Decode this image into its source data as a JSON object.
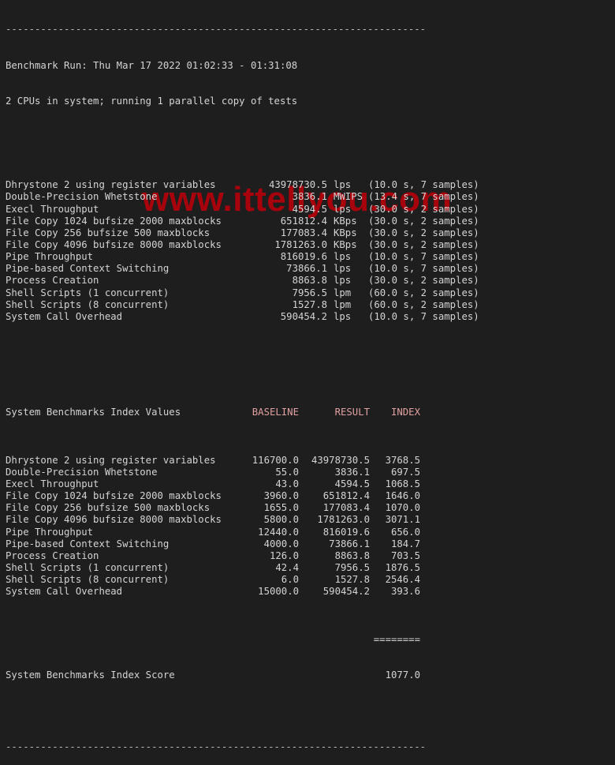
{
  "terminal": {
    "separator": "------------------------------------------------------------------------",
    "run_header": "Benchmark Run: Thu Mar 17 2022 01:02:33 - 01:31:08",
    "cpu_info": "2 CPUs in system; running 1 parallel copy of tests",
    "results": [
      {
        "name": "Dhrystone 2 using register variables",
        "value": "43978730.5",
        "unit": "lps",
        "info": "(10.0 s, 7 samples)"
      },
      {
        "name": "Double-Precision Whetstone",
        "value": "3836.1",
        "unit": "MWIPS",
        "info": "(13.4 s, 7 samples)"
      },
      {
        "name": "Execl Throughput",
        "value": "4594.5",
        "unit": "lps",
        "info": "(30.0 s, 2 samples)"
      },
      {
        "name": "File Copy 1024 bufsize 2000 maxblocks",
        "value": "651812.4",
        "unit": "KBps",
        "info": "(30.0 s, 2 samples)"
      },
      {
        "name": "File Copy 256 bufsize 500 maxblocks",
        "value": "177083.4",
        "unit": "KBps",
        "info": "(30.0 s, 2 samples)"
      },
      {
        "name": "File Copy 4096 bufsize 8000 maxblocks",
        "value": "1781263.0",
        "unit": "KBps",
        "info": "(30.0 s, 2 samples)"
      },
      {
        "name": "Pipe Throughput",
        "value": "816019.6",
        "unit": "lps",
        "info": "(10.0 s, 7 samples)"
      },
      {
        "name": "Pipe-based Context Switching",
        "value": "73866.1",
        "unit": "lps",
        "info": "(10.0 s, 7 samples)"
      },
      {
        "name": "Process Creation",
        "value": "8863.8",
        "unit": "lps",
        "info": "(30.0 s, 2 samples)"
      },
      {
        "name": "Shell Scripts (1 concurrent)",
        "value": "7956.5",
        "unit": "lpm",
        "info": "(60.0 s, 2 samples)"
      },
      {
        "name": "Shell Scripts (8 concurrent)",
        "value": "1527.8",
        "unit": "lpm",
        "info": "(60.0 s, 2 samples)"
      },
      {
        "name": "System Call Overhead",
        "value": "590454.2",
        "unit": "lps",
        "info": "(10.0 s, 7 samples)"
      }
    ],
    "index_header": {
      "title": "System Benchmarks Index Values",
      "baseline": "BASELINE",
      "result": "RESULT",
      "index": "INDEX"
    },
    "index_rows": [
      {
        "name": "Dhrystone 2 using register variables",
        "baseline": "116700.0",
        "result": "43978730.5",
        "index": "3768.5"
      },
      {
        "name": "Double-Precision Whetstone",
        "baseline": "55.0",
        "result": "3836.1",
        "index": "697.5"
      },
      {
        "name": "Execl Throughput",
        "baseline": "43.0",
        "result": "4594.5",
        "index": "1068.5"
      },
      {
        "name": "File Copy 1024 bufsize 2000 maxblocks",
        "baseline": "3960.0",
        "result": "651812.4",
        "index": "1646.0"
      },
      {
        "name": "File Copy 256 bufsize 500 maxblocks",
        "baseline": "1655.0",
        "result": "177083.4",
        "index": "1070.0"
      },
      {
        "name": "File Copy 4096 bufsize 8000 maxblocks",
        "baseline": "5800.0",
        "result": "1781263.0",
        "index": "3071.1"
      },
      {
        "name": "Pipe Throughput",
        "baseline": "12440.0",
        "result": "816019.6",
        "index": "656.0"
      },
      {
        "name": "Pipe-based Context Switching",
        "baseline": "4000.0",
        "result": "73866.1",
        "index": "184.7"
      },
      {
        "name": "Process Creation",
        "baseline": "126.0",
        "result": "8863.8",
        "index": "703.5"
      },
      {
        "name": "Shell Scripts (1 concurrent)",
        "baseline": "42.4",
        "result": "7956.5",
        "index": "1876.5"
      },
      {
        "name": "Shell Scripts (8 concurrent)",
        "baseline": "6.0",
        "result": "1527.8",
        "index": "2546.4"
      },
      {
        "name": "System Call Overhead",
        "baseline": "15000.0",
        "result": "590454.2",
        "index": "393.6"
      }
    ],
    "score_rule": "========",
    "score_label": "System Benchmarks Index Score",
    "score_value": "1077.0"
  },
  "watermark": {
    "text": "www.ittellyou.com",
    "color": "#b3000c"
  },
  "colors": {
    "background": "#1e1e1e",
    "foreground": "#d4d4d4"
  }
}
